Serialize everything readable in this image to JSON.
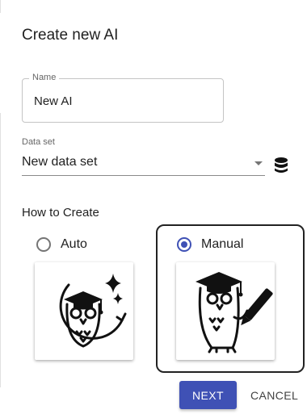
{
  "dialog": {
    "title": "Create new AI",
    "name_field": {
      "label": "Name",
      "value": "New AI"
    },
    "dataset": {
      "label": "Data set",
      "value": "New data set",
      "icon": "database-icon"
    },
    "how_to_create": {
      "label": "How to Create",
      "options": [
        {
          "label": "Auto",
          "selected": false,
          "icon": "owl-graduate-sparkle-icon"
        },
        {
          "label": "Manual",
          "selected": true,
          "icon": "owl-graduate-pencil-icon"
        }
      ]
    },
    "buttons": {
      "next": "NEXT",
      "cancel": "CANCEL"
    },
    "colors": {
      "primary": "#3f51b5",
      "text": "#212121"
    }
  }
}
